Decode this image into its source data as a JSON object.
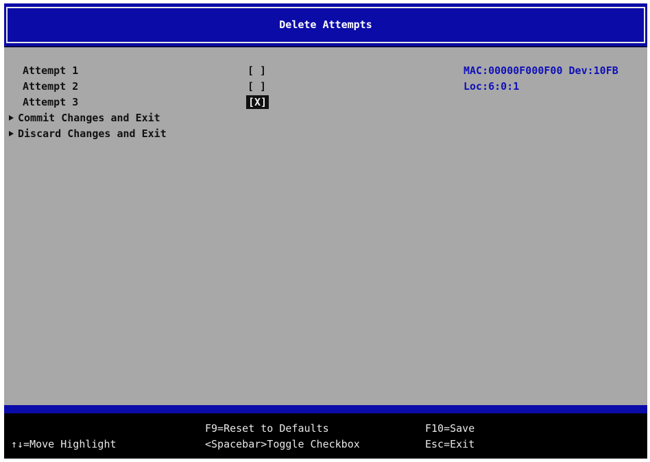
{
  "title": "Delete Attempts",
  "attempts": [
    {
      "label": "Attempt 1",
      "checkbox": "[ ]",
      "checked": false
    },
    {
      "label": "Attempt 2",
      "checkbox": "[ ]",
      "checked": false
    },
    {
      "label": "Attempt 3",
      "checkbox": "[X]",
      "checked": true
    }
  ],
  "actions": {
    "commit_label": "Commit Changes and Exit",
    "discard_label": "Discard Changes and Exit"
  },
  "info": {
    "mac_line": "MAC:00000F000F00 Dev:10FB",
    "loc_line": "Loc:6:0:1"
  },
  "footer": {
    "move_highlight": "↑↓=Move Highlight",
    "reset_defaults": "F9=Reset to Defaults",
    "toggle_checkbox": "<Spacebar>Toggle Checkbox",
    "save": "F10=Save",
    "exit": "Esc=Exit"
  },
  "colors": {
    "title_bar": "#0b0ba8",
    "background": "#a8a8a8",
    "info_text": "#1010b8",
    "footer_background": "#000000"
  }
}
